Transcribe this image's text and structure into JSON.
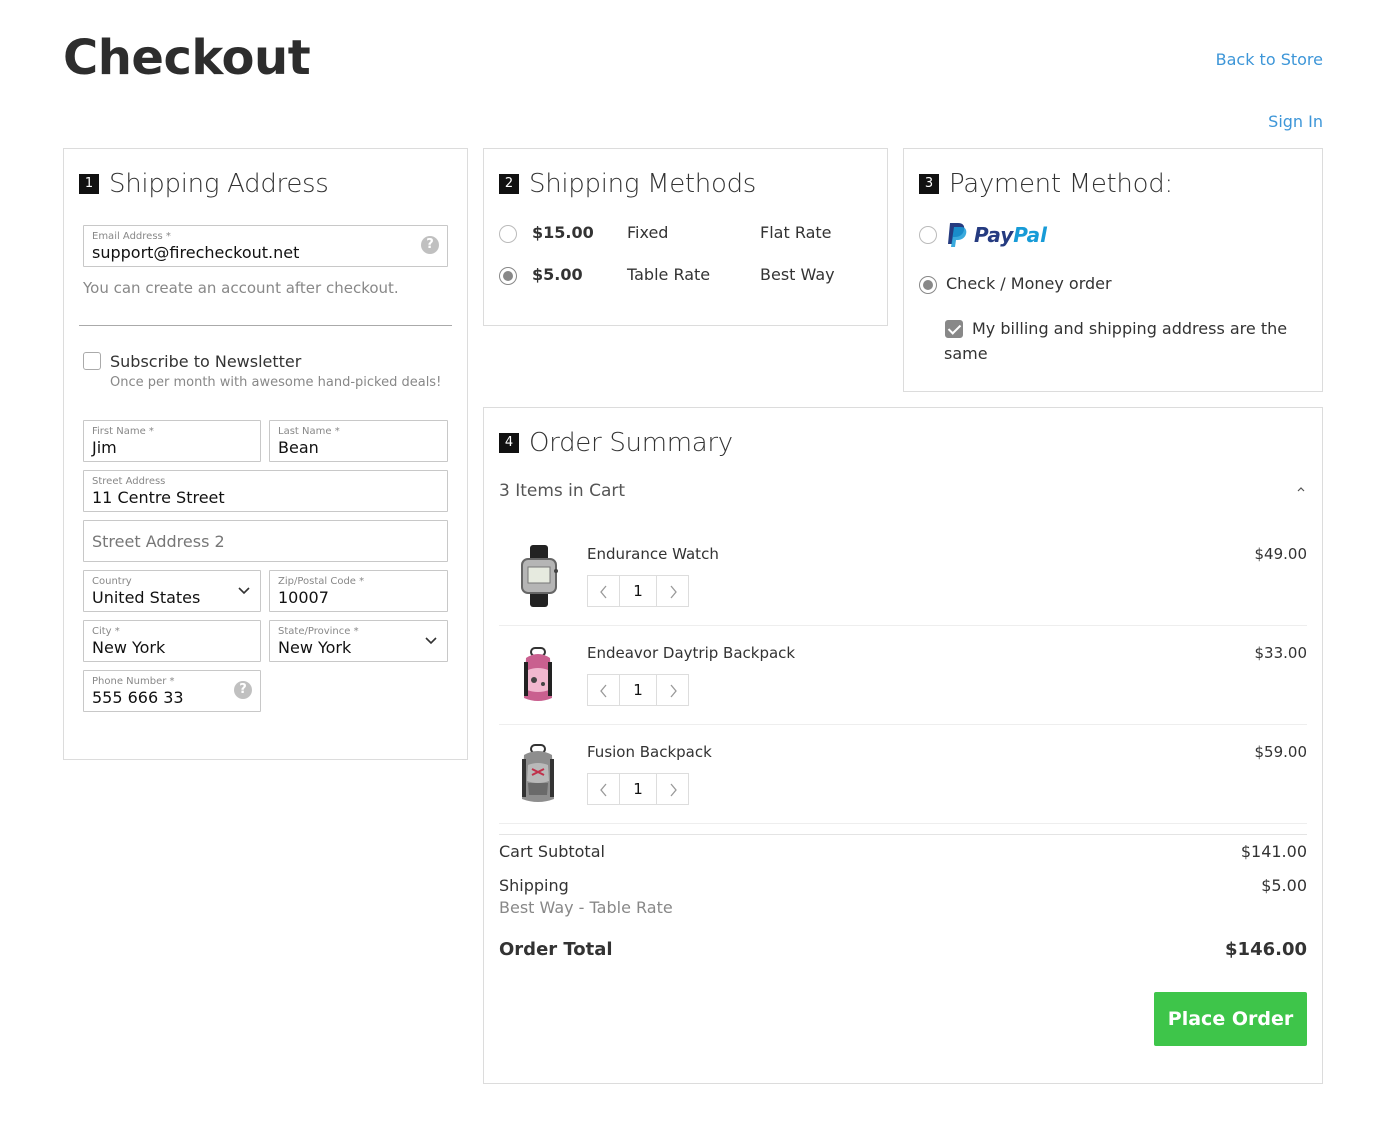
{
  "page": {
    "title": "Checkout",
    "back_link": "Back to Store",
    "signin_link": "Sign In"
  },
  "shipping_address": {
    "step": "1",
    "title": "Shipping Address",
    "email": {
      "label": "Email Address *",
      "value": "support@firecheckout.net"
    },
    "account_hint": "You can create an account after checkout.",
    "newsletter": {
      "label": "Subscribe to Newsletter",
      "sub": "Once per month with awesome hand-picked deals!",
      "checked": false
    },
    "first_name": {
      "label": "First Name *",
      "value": "Jim"
    },
    "last_name": {
      "label": "Last Name *",
      "value": "Bean"
    },
    "street": {
      "label": "Street Address",
      "value": "11 Centre Street"
    },
    "street2": {
      "placeholder": "Street Address 2"
    },
    "country": {
      "label": "Country",
      "value": "United States"
    },
    "zip": {
      "label": "Zip/Postal Code *",
      "value": "10007"
    },
    "city": {
      "label": "City *",
      "value": "New York"
    },
    "state": {
      "label": "State/Province *",
      "value": "New York"
    },
    "phone": {
      "label": "Phone Number *",
      "value": "555 666 33"
    }
  },
  "shipping_methods": {
    "step": "2",
    "title": "Shipping Methods",
    "options": [
      {
        "price": "$15.00",
        "method": "Fixed",
        "carrier": "Flat Rate",
        "selected": false
      },
      {
        "price": "$5.00",
        "method": "Table Rate",
        "carrier": "Best Way",
        "selected": true
      }
    ]
  },
  "payment": {
    "step": "3",
    "title": "Payment Method:",
    "paypal": {
      "word1": "Pay",
      "word2": "Pal",
      "selected": false
    },
    "check_money": {
      "label": "Check / Money order",
      "selected": true
    },
    "same_address": {
      "label": "My billing and shipping address are the same",
      "checked": true
    }
  },
  "summary": {
    "step": "4",
    "title": "Order Summary",
    "cart_count": "3 Items in Cart",
    "items": [
      {
        "name": "Endurance Watch",
        "price": "$49.00",
        "qty": "1"
      },
      {
        "name": "Endeavor Daytrip Backpack",
        "price": "$33.00",
        "qty": "1"
      },
      {
        "name": "Fusion Backpack",
        "price": "$59.00",
        "qty": "1"
      }
    ],
    "subtotal_label": "Cart Subtotal",
    "subtotal_value": "$141.00",
    "shipping_label": "Shipping",
    "shipping_detail": "Best Way - Table Rate",
    "shipping_value": "$5.00",
    "total_label": "Order Total",
    "total_value": "$146.00",
    "place_order": "Place Order"
  },
  "colors": {
    "link": "#3d96d8",
    "accent_button": "#3ec54a",
    "step_badge": "#111111"
  },
  "icons": [
    "help-icon",
    "chevron-down-icon",
    "chevron-up-icon",
    "chevron-left-icon",
    "chevron-right-icon",
    "paypal-logo-icon",
    "check-icon"
  ]
}
